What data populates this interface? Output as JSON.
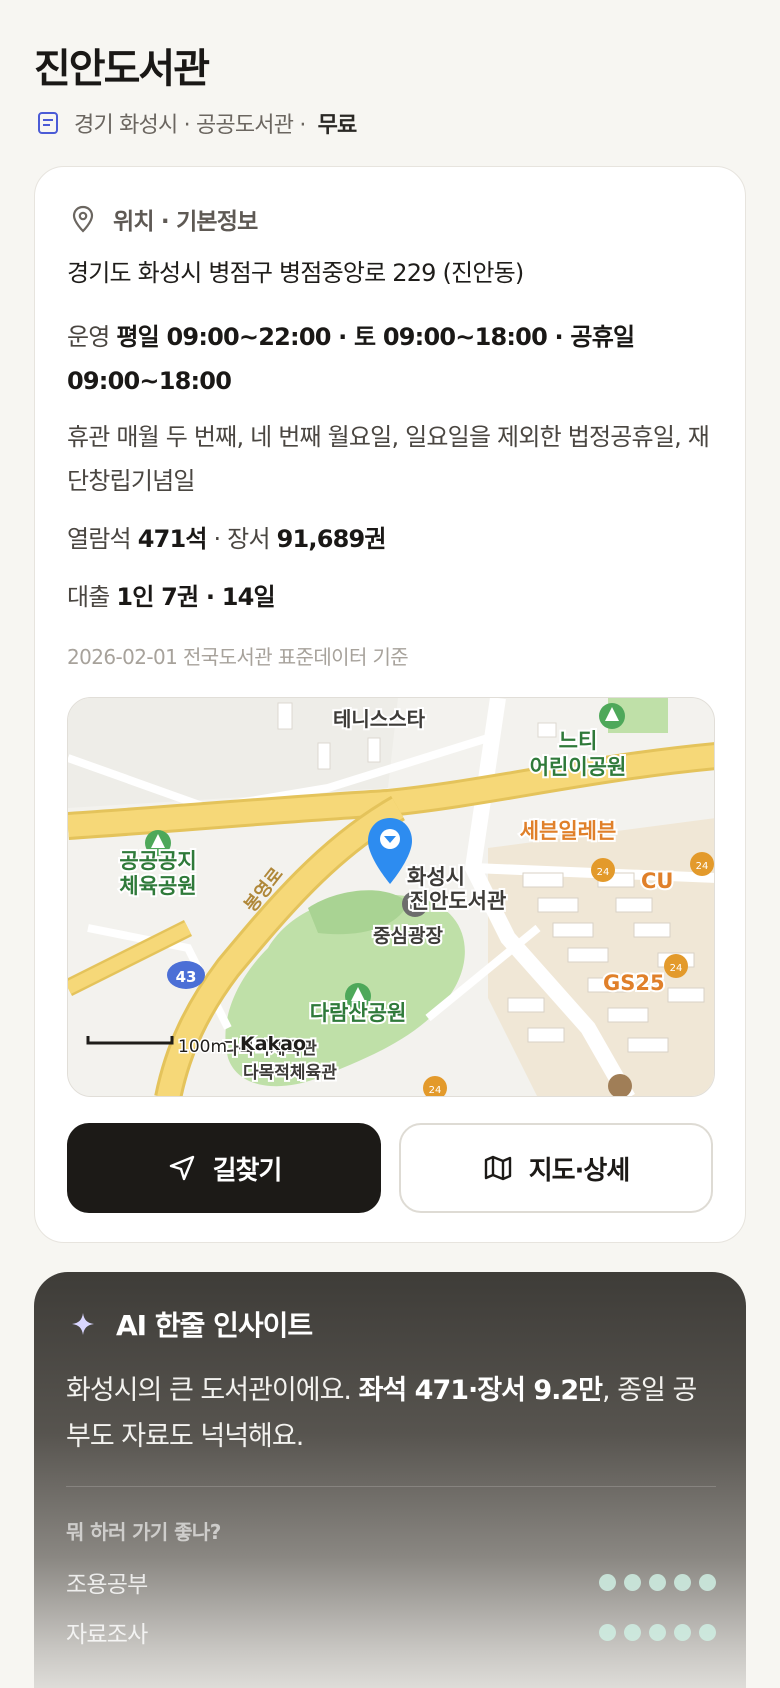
{
  "header": {
    "title": "진안도서관",
    "subtitle": "경기 화성시 · 공공도서관 ·",
    "price": "무료"
  },
  "info": {
    "section_title": "위치 · 기본정보",
    "address": "경기도 화성시 병점구 병점중앙로 229 (진안동)",
    "hours_label": "운영",
    "hours_value": "평일 09:00~22:00 · 토 09:00~18:00 · 공휴일 09:00~18:00",
    "closed": "휴관 매월 두 번째, 네 번째 월요일, 일요일을 제외한 법정공휴일, 재단창립기념일",
    "seats_label": "열람석",
    "seats_value": "471석",
    "books_label": "· 장서",
    "books_value": "91,689권",
    "loan_label": "대출",
    "loan_value": "1인 7권 · 14일",
    "data_date": "2026-02-01 전국도서관 표준데이터 기준"
  },
  "map": {
    "labels": {
      "tennis": "테니스스타",
      "park_a1": "느티",
      "park_a2": "어린이공원",
      "park_b1": "공공공지",
      "park_b2": "체육공원",
      "library1": "화성시",
      "library2": "진안도서관",
      "plaza": "중심광장",
      "darasan": "다람산공원",
      "road": "봉영로",
      "route_no": "43",
      "store_711": "세븐일레븐",
      "store_cu": "CU",
      "store_gs": "GS25",
      "store_24": "24",
      "overlap": "다목적체육관",
      "bottom_cut": "다목적체육관",
      "scale": "100m",
      "brand": "Kakao"
    }
  },
  "buttons": {
    "route": "길찾기",
    "map_detail": "지도·상세"
  },
  "ai": {
    "title": "AI 한줄 인사이트",
    "body_pre": "화성시의 큰 도서관이에요. ",
    "body_bold": "좌석 471·장서 9.2만",
    "body_post": ", 종일 공부도 자료도 넉넉해요.",
    "good_for_title": "뭐 하러 가기 좋나?",
    "items": [
      {
        "label": "조용공부",
        "score": 5
      },
      {
        "label": "자료조사",
        "score": 5
      }
    ]
  },
  "colors": {
    "map_road": "#f6d878",
    "map_park": "#bfe0a8",
    "map_marker": "#2d8cf0",
    "park_icon": "#4ea85a",
    "store_orange": "#e39a2b",
    "ai_dot": "#cfeee3"
  }
}
